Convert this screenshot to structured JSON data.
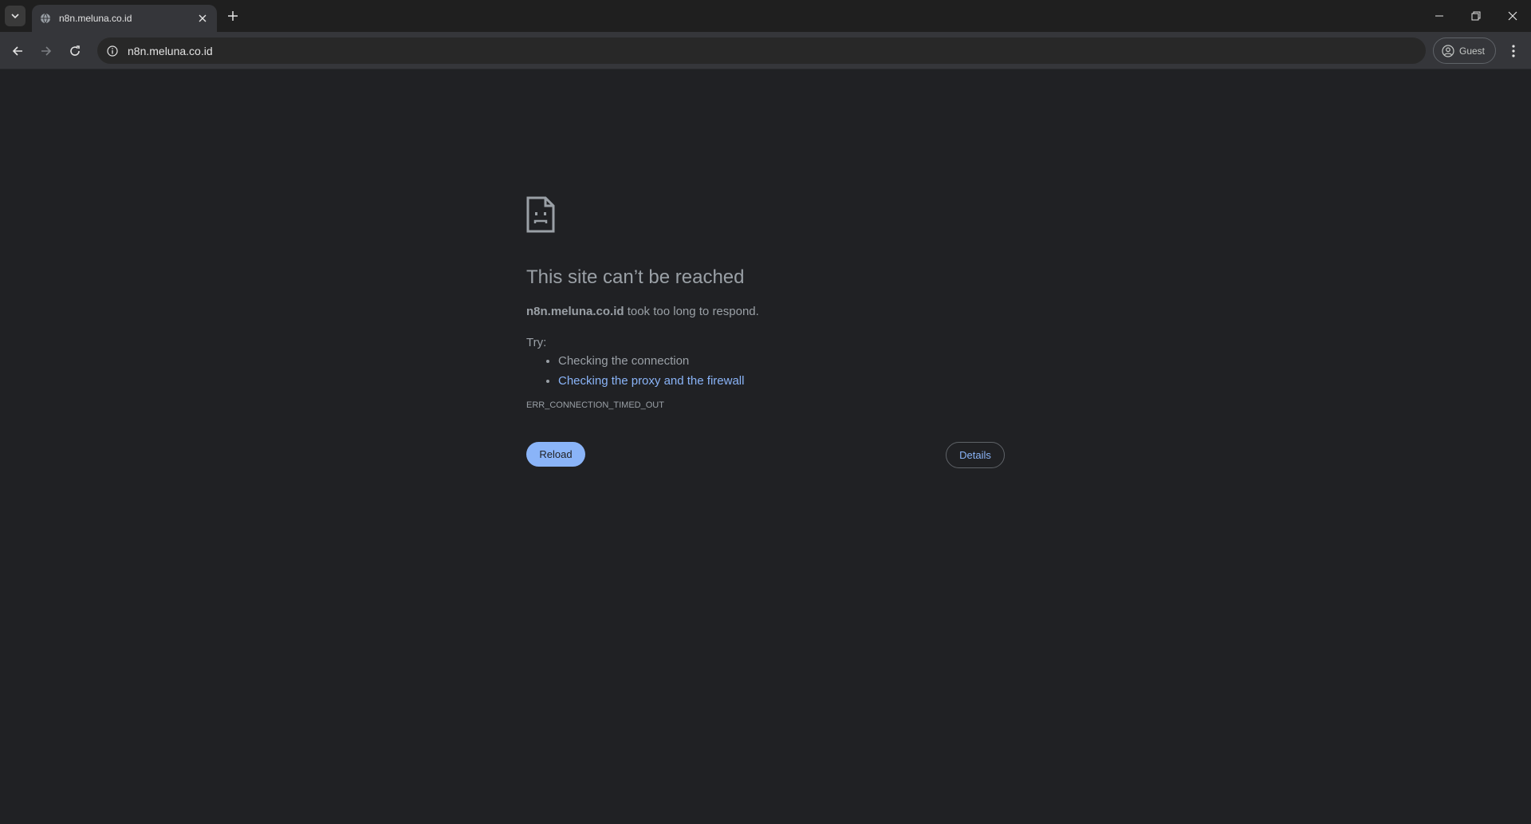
{
  "browser": {
    "tab": {
      "title": "n8n.meluna.co.id"
    },
    "omnibox": {
      "url": "n8n.meluna.co.id"
    },
    "profile": {
      "label": "Guest"
    },
    "icons": {
      "tab_search": "chevron-down-icon",
      "favicon": "globe-icon",
      "tab_close": "close-icon",
      "new_tab": "plus-icon",
      "back": "arrow-left-icon",
      "forward": "arrow-right-icon",
      "reload": "reload-icon",
      "site_info": "info-icon",
      "profile": "person-circle-icon",
      "menu": "kebab-menu-icon",
      "minimize": "minimize-icon",
      "restore": "restore-icon",
      "close": "close-icon"
    }
  },
  "error_page": {
    "icon": "sad-page-icon",
    "heading": "This site can’t be reached",
    "host": "n8n.meluna.co.id",
    "message": " took too long to respond.",
    "try_label": "Try:",
    "suggestions": [
      {
        "text": "Checking the connection",
        "link": false
      },
      {
        "text": "Checking the proxy and the firewall",
        "link": true
      }
    ],
    "error_code": "ERR_CONNECTION_TIMED_OUT",
    "reload_label": "Reload",
    "details_label": "Details"
  },
  "colors": {
    "page_bg": "#202124",
    "text": "#9aa0a6",
    "link": "#8ab4f8",
    "button_primary": "#8ab4f8"
  }
}
